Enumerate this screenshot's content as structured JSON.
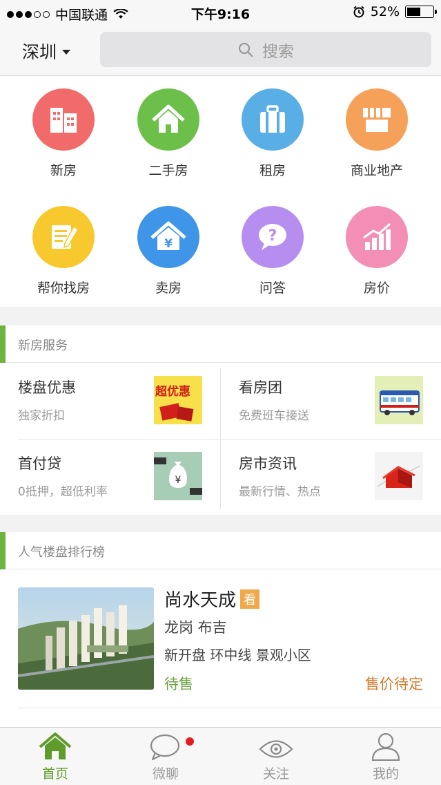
{
  "status_bar": {
    "carrier": "中国联通",
    "time": "下午9:16",
    "battery": "52%",
    "battery_level": 0.52
  },
  "header": {
    "city": "深圳",
    "search_placeholder": "搜索"
  },
  "categories": [
    {
      "label": "新房",
      "icon": "building-icon",
      "color": "#f26b6b"
    },
    {
      "label": "二手房",
      "icon": "house-icon",
      "color": "#6cc04a"
    },
    {
      "label": "租房",
      "icon": "suitcase-icon",
      "color": "#5aaee6"
    },
    {
      "label": "商业地产",
      "icon": "storefront-icon",
      "color": "#f5a15a"
    },
    {
      "label": "帮你找房",
      "icon": "note-pencil-icon",
      "color": "#f7c92e"
    },
    {
      "label": "卖房",
      "icon": "house-yuan-icon",
      "color": "#3f95e8"
    },
    {
      "label": "问答",
      "icon": "question-bubble-icon",
      "color": "#b58ef0"
    },
    {
      "label": "房价",
      "icon": "bar-chart-icon",
      "color": "#f38fb5"
    }
  ],
  "new_house_service": {
    "title": "新房服务",
    "items": [
      {
        "title": "楼盘优惠",
        "subtitle": "独家折扣",
        "image": "super-discount-image",
        "image_text": "超优惠"
      },
      {
        "title": "看房团",
        "subtitle": "免费班车接送",
        "image": "bus-image"
      },
      {
        "title": "首付贷",
        "subtitle": "0抵押，超低利率",
        "image": "money-bag-image"
      },
      {
        "title": "房市资讯",
        "subtitle": "最新行情、热点",
        "image": "red-house-chart-image"
      }
    ]
  },
  "ranking": {
    "title": "人气楼盘排行榜",
    "items": [
      {
        "name": "尚水天成",
        "tag": "看",
        "area": "龙岗 布吉",
        "features": "新开盘 环中线 景观小区",
        "status": "待售",
        "price": "售价待定"
      }
    ]
  },
  "tabbar": {
    "tabs": [
      {
        "label": "首页",
        "icon": "home-icon",
        "active": true
      },
      {
        "label": "微聊",
        "icon": "chat-bubble-icon",
        "active": false,
        "badge": true
      },
      {
        "label": "关注",
        "icon": "eye-icon",
        "active": false
      },
      {
        "label": "我的",
        "icon": "person-icon",
        "active": false
      }
    ]
  }
}
